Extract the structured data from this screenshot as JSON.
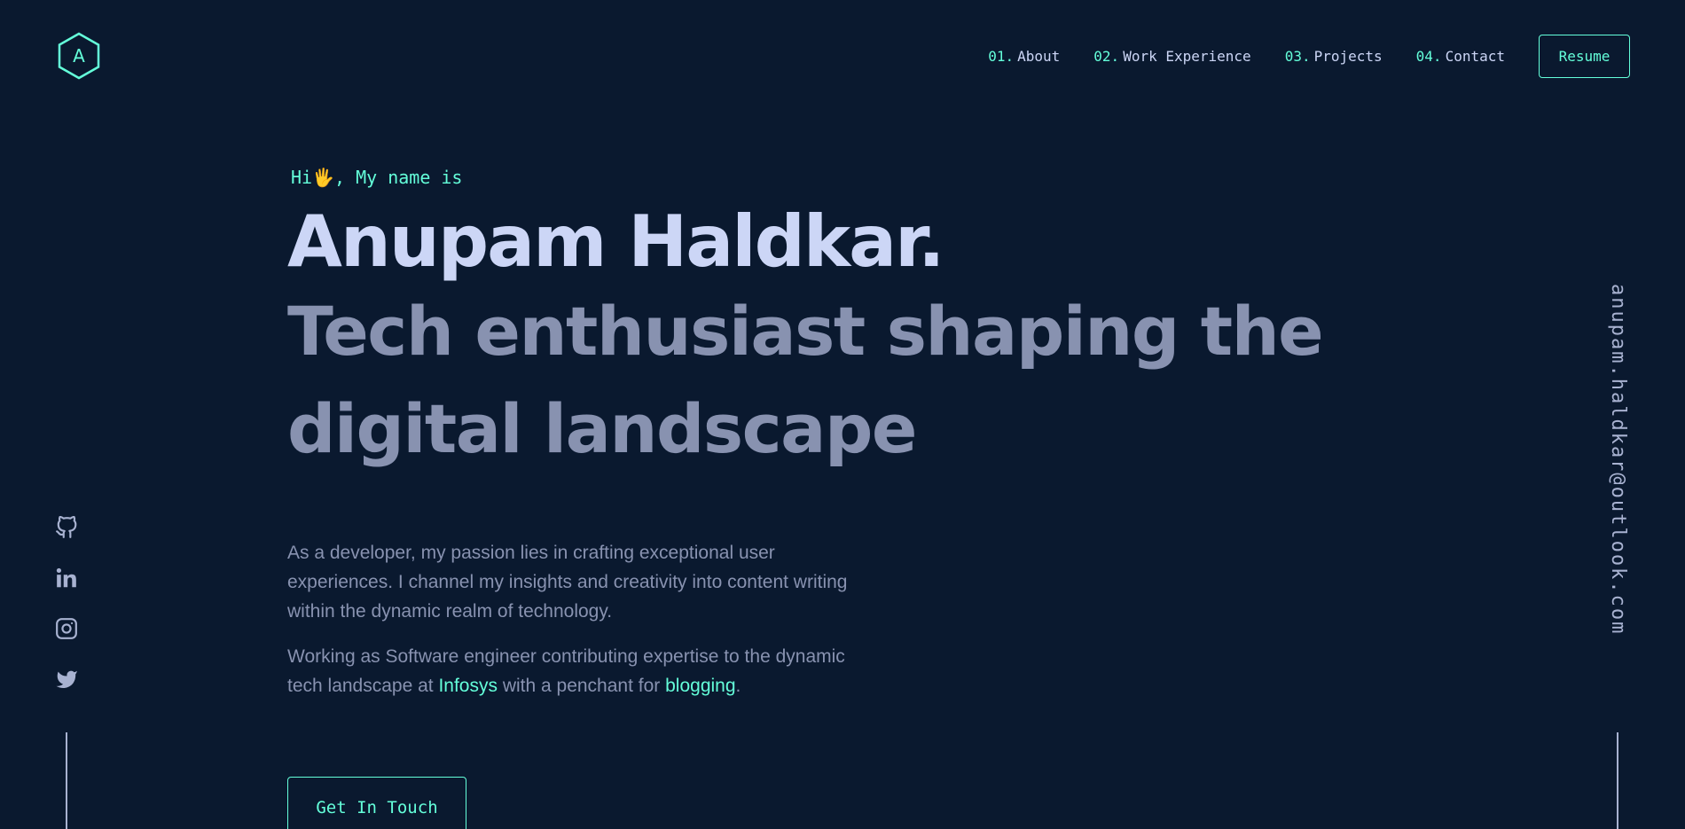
{
  "header": {
    "logo_letter": "A",
    "nav": [
      {
        "num": "01.",
        "label": "About"
      },
      {
        "num": "02.",
        "label": "Work Experience"
      },
      {
        "num": "03.",
        "label": "Projects"
      },
      {
        "num": "04.",
        "label": "Contact"
      }
    ],
    "resume_label": "Resume"
  },
  "hero": {
    "greeting": "Hi🖐, My name is",
    "name": "Anupam Haldkar.",
    "tagline": "Tech enthusiast shaping the digital landscape",
    "intro_1": "As a developer, my passion lies in crafting exceptional user experiences. I channel my insights and creativity into content writing within the dynamic realm of technology.",
    "intro_2_before": "Working as Software engineer contributing expertise to the dynamic tech landscape at ",
    "intro_2_company": "Infosys",
    "intro_2_middle": " with a penchant for ",
    "intro_2_link": "blogging",
    "intro_2_end": ".",
    "cta_label": "Get In Touch"
  },
  "social": {
    "icons": [
      "github-icon",
      "linkedin-icon",
      "instagram-icon",
      "twitter-icon"
    ]
  },
  "email": "anupam.haldkar@outlook.com",
  "colors": {
    "background": "#0a192f",
    "accent": "#64ffda",
    "heading": "#ccd6f6",
    "muted": "#8892b0",
    "rail": "#a8b2d1"
  }
}
